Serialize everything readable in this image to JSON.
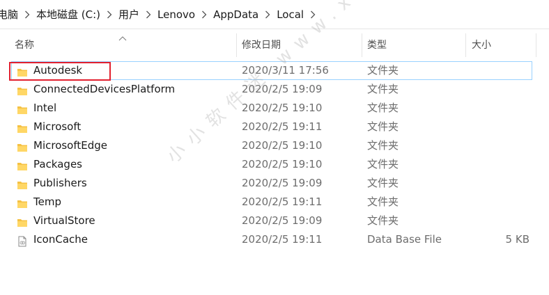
{
  "breadcrumb": [
    "电脑",
    "本地磁盘 (C:)",
    "用户",
    "Lenovo",
    "AppData",
    "Local"
  ],
  "columns": {
    "name": "名称",
    "date": "修改日期",
    "type": "类型",
    "size": "大小"
  },
  "rows": [
    {
      "name": "Autodesk",
      "date": "2020/3/11 17:56",
      "type": "文件夹",
      "size": "",
      "icon": "folder-icon"
    },
    {
      "name": "ConnectedDevicesPlatform",
      "date": "2020/2/5 19:09",
      "type": "文件夹",
      "size": "",
      "icon": "folder-icon"
    },
    {
      "name": "Intel",
      "date": "2020/2/5 19:10",
      "type": "文件夹",
      "size": "",
      "icon": "folder-icon"
    },
    {
      "name": "Microsoft",
      "date": "2020/2/5 19:11",
      "type": "文件夹",
      "size": "",
      "icon": "folder-icon"
    },
    {
      "name": "MicrosoftEdge",
      "date": "2020/2/5 19:10",
      "type": "文件夹",
      "size": "",
      "icon": "folder-icon"
    },
    {
      "name": "Packages",
      "date": "2020/2/5 19:10",
      "type": "文件夹",
      "size": "",
      "icon": "folder-icon"
    },
    {
      "name": "Publishers",
      "date": "2020/2/5 19:09",
      "type": "文件夹",
      "size": "",
      "icon": "folder-icon"
    },
    {
      "name": "Temp",
      "date": "2020/2/5 19:11",
      "type": "文件夹",
      "size": "",
      "icon": "folder-icon"
    },
    {
      "name": "VirtualStore",
      "date": "2020/2/5 19:09",
      "type": "文件夹",
      "size": "",
      "icon": "folder-icon"
    },
    {
      "name": "IconCache",
      "date": "2020/2/5 19:11",
      "type": "Data Base File",
      "size": "5 KB",
      "icon": "file-icon"
    }
  ],
  "watermark": "小小软件迷 www.xxrjm.com",
  "colors": {
    "folder": "#f5c143",
    "highlight_border": "#e2202f",
    "hover_border": "#99d1ff"
  }
}
